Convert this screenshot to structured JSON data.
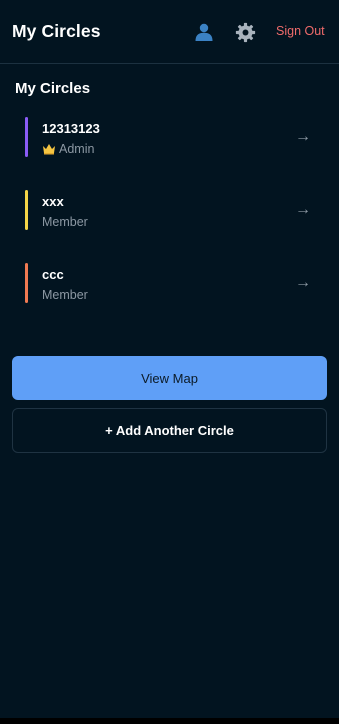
{
  "header": {
    "title": "My Circles",
    "profile_icon": "user-icon",
    "settings_icon": "gear-icon",
    "sign_out_label": "Sign Out"
  },
  "section": {
    "title": "My Circles"
  },
  "circles": [
    {
      "name": "12313123",
      "role": "Admin",
      "role_icon": "crown-icon",
      "color": "#8b5cf6",
      "arrow": "→"
    },
    {
      "name": "xxx",
      "role": "Member",
      "color": "#f5d547",
      "arrow": "→"
    },
    {
      "name": "ccc",
      "role": "Member",
      "color": "#f07a52",
      "arrow": "→"
    }
  ],
  "actions": {
    "view_map_label": "View Map",
    "add_circle_label": "+ Add Another Circle"
  },
  "colors": {
    "background": "#021420",
    "accent": "#5f9ff7",
    "sign_out": "#ef6b6b"
  }
}
